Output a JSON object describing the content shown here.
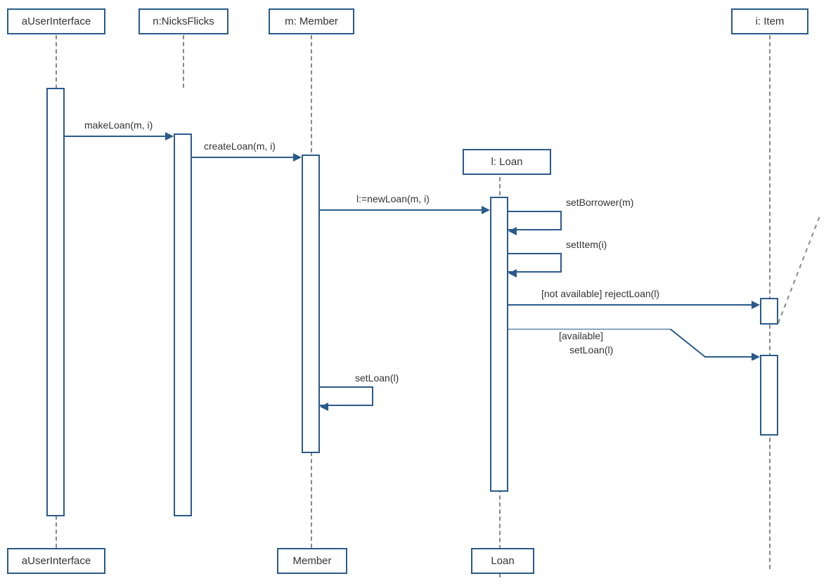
{
  "participants": {
    "ui": "aUserInterface",
    "nf": "n:NicksFlicks",
    "member": "m: Member",
    "loan": "l: Loan",
    "item": "i: Item"
  },
  "messages": {
    "makeLoan": "makeLoan(m, i)",
    "createLoan": "createLoan(m, i)",
    "newLoan": "l:=newLoan(m, i)",
    "setBorrower": "setBorrower(m)",
    "setItem": "setItem(i)",
    "rejectLoan": "[not available] rejectLoan(l)",
    "setLoanAvail1": "[available]",
    "setLoanAvail2": "setLoan(l)",
    "setLoanMember": "setLoan(l)"
  },
  "footers": {
    "ui": "aUserInterface",
    "member": "Member",
    "loan": "Loan"
  }
}
